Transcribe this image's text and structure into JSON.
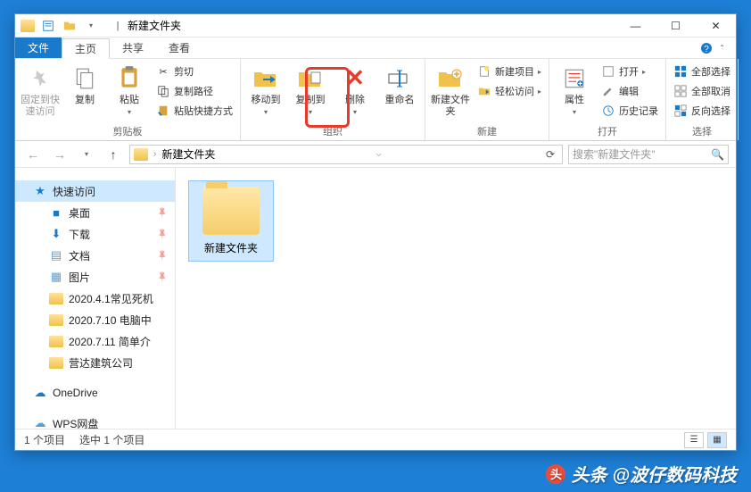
{
  "window": {
    "title": "新建文件夹",
    "controls": {
      "min": "—",
      "max": "☐",
      "close": "✕"
    }
  },
  "tabs": {
    "file": "文件",
    "home": "主页",
    "share": "共享",
    "view": "查看"
  },
  "ribbon": {
    "clipboard": {
      "label": "剪贴板",
      "pin": "固定到快速访问",
      "copy": "复制",
      "paste": "粘贴",
      "cut": "剪切",
      "copy_path": "复制路径",
      "paste_shortcut": "粘贴快捷方式"
    },
    "organize": {
      "label": "组织",
      "move_to": "移动到",
      "copy_to": "复制到",
      "delete": "删除",
      "rename": "重命名"
    },
    "new": {
      "label": "新建",
      "new_folder": "新建文件夹",
      "new_item": "新建项目",
      "easy_access": "轻松访问"
    },
    "open": {
      "label": "打开",
      "properties": "属性",
      "open": "打开",
      "edit": "编辑",
      "history": "历史记录"
    },
    "select": {
      "label": "选择",
      "select_all": "全部选择",
      "select_none": "全部取消",
      "invert": "反向选择"
    }
  },
  "address": {
    "segment": "新建文件夹",
    "search_placeholder": "搜索\"新建文件夹\""
  },
  "nav": {
    "quick_access": "快速访问",
    "desktop": "桌面",
    "downloads": "下载",
    "documents": "文档",
    "pictures": "图片",
    "f1": "2020.4.1常见死机",
    "f2": "2020.7.10 电脑中",
    "f3": "2020.7.11 简单介",
    "f4": "营达建筑公司",
    "onedrive": "OneDrive",
    "wps": "WPS网盘"
  },
  "content": {
    "item1": "新建文件夹"
  },
  "status": {
    "count": "1 个项目",
    "selected": "选中 1 个项目"
  },
  "watermark": {
    "prefix": "头条",
    "text": "@波仔数码科技"
  }
}
